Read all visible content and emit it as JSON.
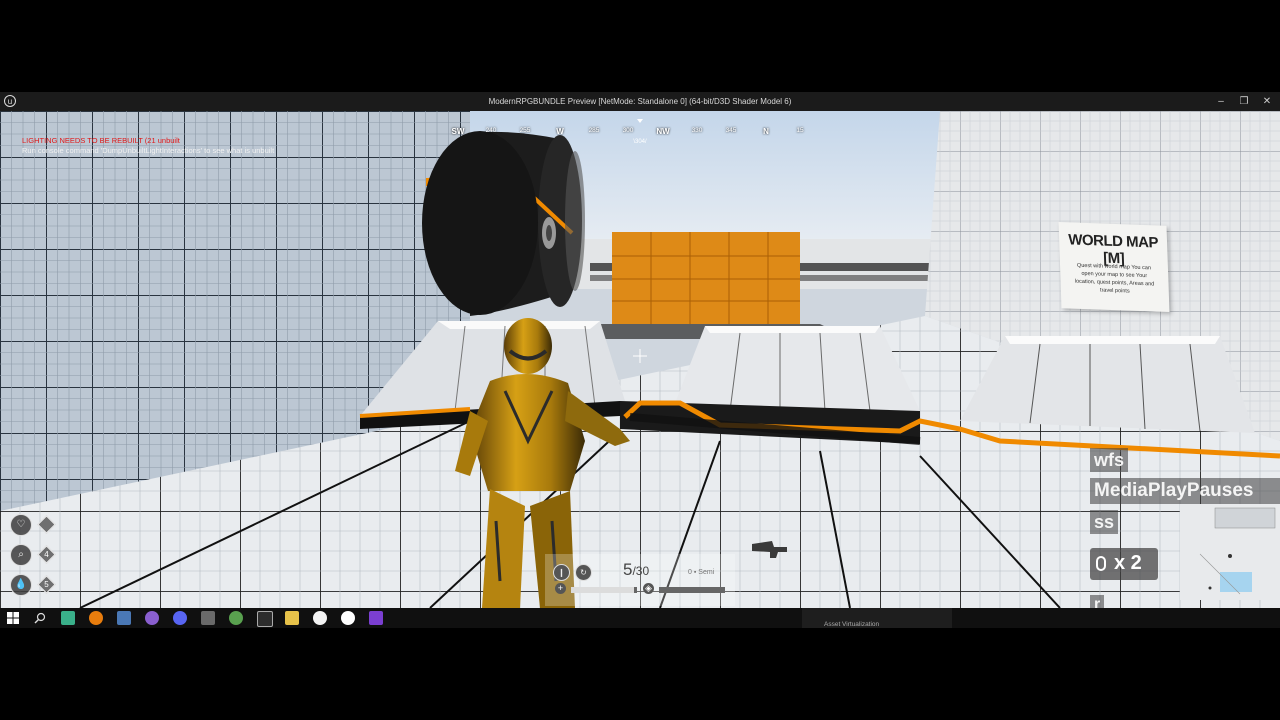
{
  "window": {
    "title": "ModernRPGBUNDLE Preview [NetMode: Standalone 0]  (64-bit/D3D Shader Model 6)",
    "controls": [
      "–",
      "❐",
      "✕"
    ]
  },
  "console": {
    "warning": "LIGHTING NEEDS TO BE REBUILT (21 unbuilt",
    "message": "Run console command 'DumpUnbuiltLightInteractions' to see what is unbuilt"
  },
  "compass": {
    "ticks": [
      "SW",
      "240",
      "255",
      "W",
      "285",
      "300",
      "NW",
      "330",
      "345",
      "N",
      "15"
    ],
    "heading": "\\304/"
  },
  "world_map_sign": {
    "title": "WORLD MAP [M]",
    "body": "Quest with world map You can open your map to see Your location, quest points, Areas and travel points"
  },
  "status_icons": [
    {
      "icon": "heart-icon",
      "value": "",
      "glyph": "♡"
    },
    {
      "icon": "search-icon",
      "value": "4",
      "glyph": "⌕"
    },
    {
      "icon": "drop-icon",
      "value": "5",
      "glyph": "💧"
    }
  ],
  "ammo": {
    "current": "5",
    "max": "/30",
    "reserve": "0",
    "mode": "Semi",
    "bar1_fill": 0.95,
    "bar2_fill": 0.0
  },
  "key_overlay": {
    "lines": [
      "wfs",
      "MediaPlayPauses",
      "ss"
    ],
    "combo": "x 2",
    "last": "r"
  },
  "taskbar": {
    "tooltip": "Asset Virtualization",
    "icons": [
      "windows-start-icon",
      "search-icon",
      "file-manager-icon",
      "blender-icon",
      "calculator-icon",
      "github-icon",
      "discord-icon",
      "steam-icon",
      "chrome-icon",
      "terminal-icon",
      "folder-icon",
      "yandex-icon",
      "unreal-icon",
      "visual-studio-icon"
    ]
  },
  "colors": {
    "accent_orange": "#f08a00",
    "grid_dark": "#1e2833",
    "armor_gold": "#c9940e"
  }
}
